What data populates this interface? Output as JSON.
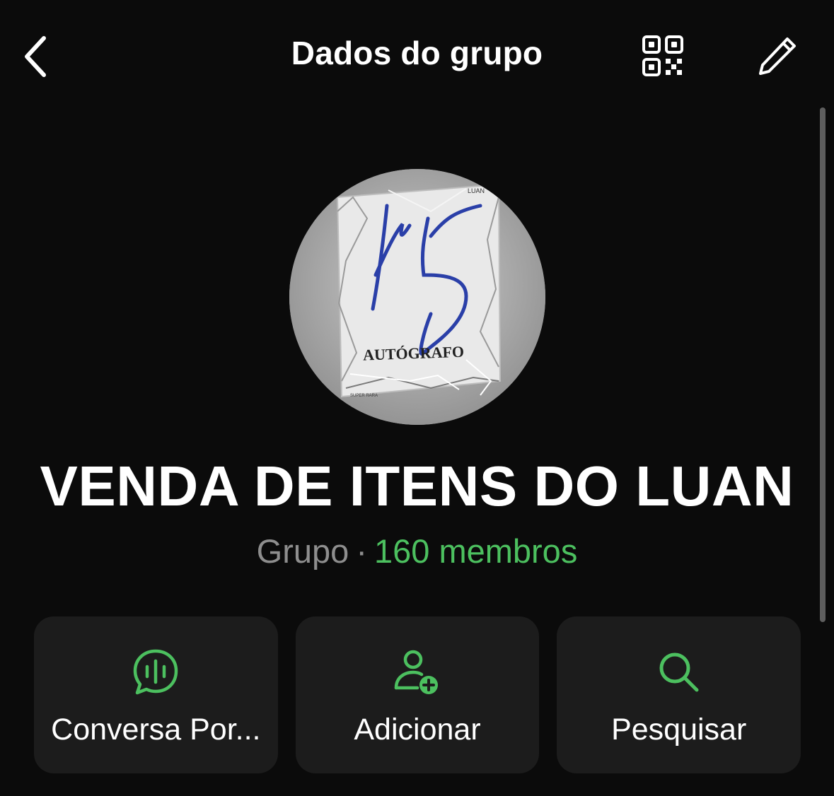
{
  "header": {
    "title": "Dados do grupo",
    "back_icon": "chevron-left-icon",
    "qr_icon": "qr-code-icon",
    "edit_icon": "pencil-icon"
  },
  "avatar": {
    "card_text": "AUTÓGRAFO",
    "corner_text": "LUAN",
    "footer_text": "SUPER RARA"
  },
  "group": {
    "name": "VENDA DE ITENS DO LUAN",
    "type": "Grupo",
    "separator": "·",
    "members": "160 membros"
  },
  "actions": [
    {
      "label": "Conversa Por...",
      "icon": "voice-chat-icon"
    },
    {
      "label": "Adicionar",
      "icon": "add-person-icon"
    },
    {
      "label": "Pesquisar",
      "icon": "search-icon"
    }
  ],
  "colors": {
    "background": "#0b0b0b",
    "card": "#1c1c1c",
    "accent": "#4cc05f",
    "muted": "#8e8e8e"
  }
}
